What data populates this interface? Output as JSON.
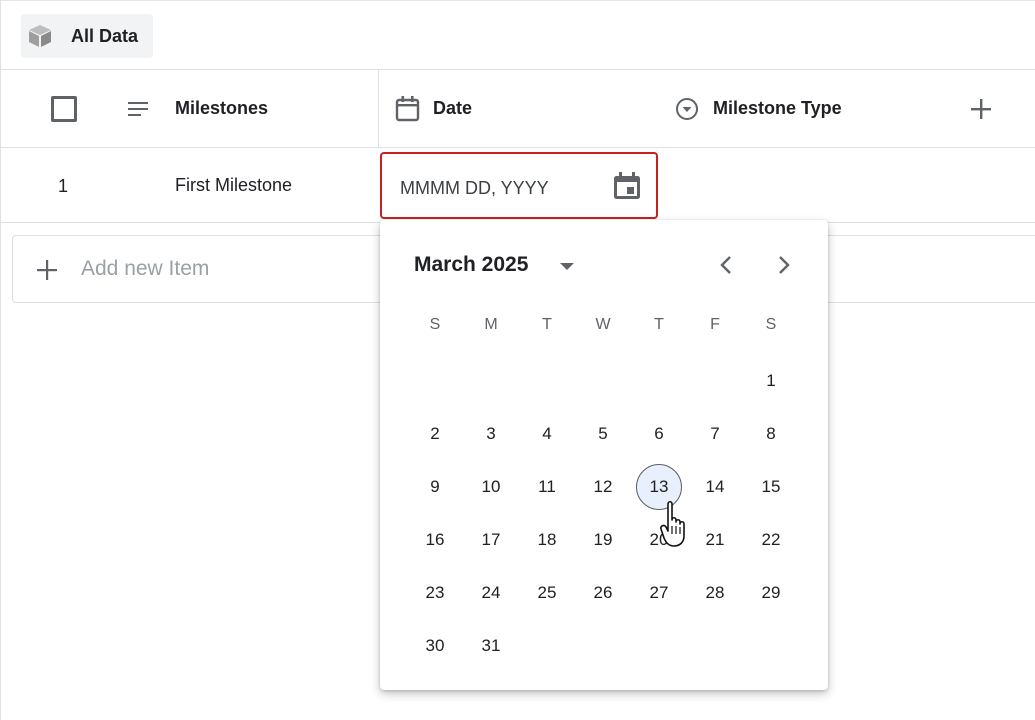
{
  "view_tab": {
    "label": "All Data",
    "icon": "cube-icon"
  },
  "columns": [
    {
      "label": "Milestones",
      "icon": "text-lines-icon"
    },
    {
      "label": "Date",
      "icon": "calendar-icon"
    },
    {
      "label": "Milestone Type",
      "icon": "dropdown-circle-icon"
    }
  ],
  "rows": [
    {
      "index": "1",
      "milestone": "First Milestone"
    }
  ],
  "date_input": {
    "placeholder": "MMMM DD, YYYY"
  },
  "add_item": {
    "label": "Add new Item"
  },
  "calendar": {
    "month_label": "March 2025",
    "weekdays": [
      "S",
      "M",
      "T",
      "W",
      "T",
      "F",
      "S"
    ],
    "first_weekday_index": 6,
    "days_in_month": 31,
    "selected_day": 13
  },
  "colors": {
    "error_border": "#c5221f",
    "selected_day_bg": "#e8f0fe"
  }
}
